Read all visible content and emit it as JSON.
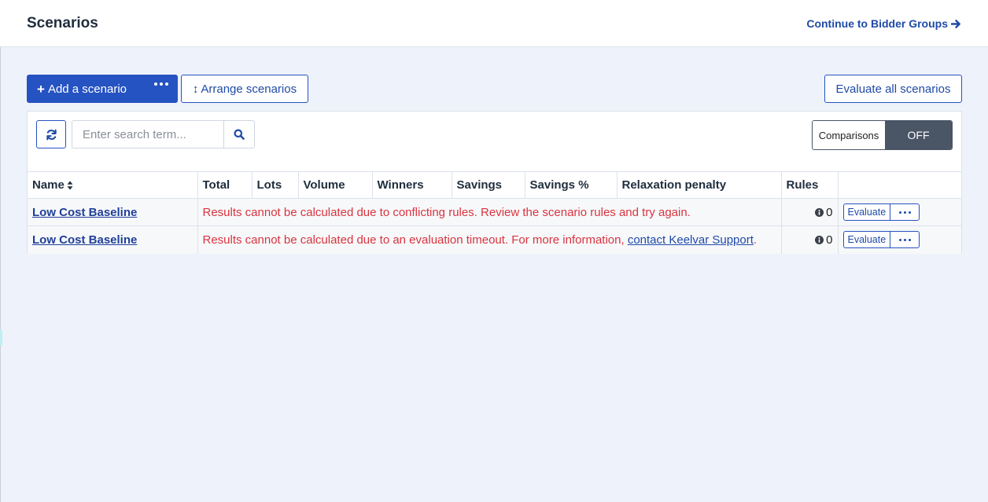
{
  "header": {
    "title": "Scenarios",
    "continue_label": "Continue to Bidder Groups",
    "continue_icon": "arrow-right-icon"
  },
  "toolbar": {
    "add_label": "Add a scenario",
    "add_icon": "plus-icon",
    "add_more_icon": "ellipsis-icon",
    "arrange_label": "Arrange scenarios",
    "arrange_icon": "arrows-vertical-icon",
    "evaluate_all_label": "Evaluate all scenarios"
  },
  "panel": {
    "refresh_icon": "refresh-icon",
    "search_placeholder": "Enter search term...",
    "search_value": "",
    "search_icon": "search-icon",
    "comparisons_label": "Comparisons",
    "comparisons_state": "OFF"
  },
  "table": {
    "columns": [
      "Name",
      "Total",
      "Lots",
      "Volume",
      "Winners",
      "Savings",
      "Savings %",
      "Relaxation penalty",
      "Rules",
      ""
    ],
    "rows": [
      {
        "name": "Low Cost Baseline",
        "message": "Results cannot be calculated due to conflicting rules. Review the scenario rules and try again.",
        "message_link": "",
        "message_suffix": "",
        "rules": "0",
        "evaluate_label": "Evaluate"
      },
      {
        "name": "Low Cost Baseline",
        "message": "Results cannot be calculated due to an evaluation timeout. For more information, ",
        "message_link": "contact Keelvar Support",
        "message_suffix": ".",
        "rules": "0",
        "evaluate_label": "Evaluate"
      }
    ]
  },
  "colors": {
    "primary": "#2653c2",
    "link": "#1f4aa8",
    "error": "#d9343f",
    "toggle_dark": "#4a5566",
    "page_bg": "#eef2fa"
  }
}
